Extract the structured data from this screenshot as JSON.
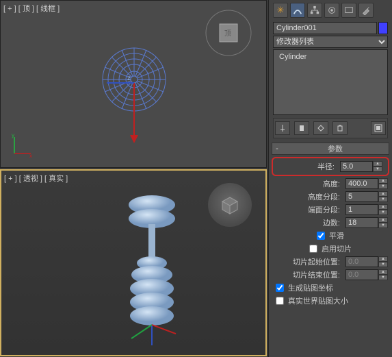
{
  "viewport_top_label": "[ + ] [ 顶 ] [ 线框 ]",
  "viewport_persp_label": "[ + ] [ 透视 ] [ 真实 ]",
  "object_name": "Cylinder001",
  "modifier_list_label": "修改器列表",
  "stack_item": "Cylinder",
  "rollup_title": "参数",
  "params": {
    "radius": {
      "label": "半径:",
      "value": "5.0"
    },
    "height": {
      "label": "高度:",
      "value": "400.0"
    },
    "height_segs": {
      "label": "高度分段:",
      "value": "5"
    },
    "cap_segs": {
      "label": "端面分段:",
      "value": "1"
    },
    "sides": {
      "label": "边数:",
      "value": "18"
    }
  },
  "smooth_label": "平滑",
  "slice_on_label": "启用切片",
  "slice_from": {
    "label": "切片起始位置:",
    "value": "0.0"
  },
  "slice_to": {
    "label": "切片结束位置:",
    "value": "0.0"
  },
  "gen_map_label": "生成贴图坐标",
  "real_world_label": "真实世界贴图大小",
  "colors": {
    "accent_blue": "#5a7ad0",
    "highlight_red": "#cc2b2b"
  }
}
